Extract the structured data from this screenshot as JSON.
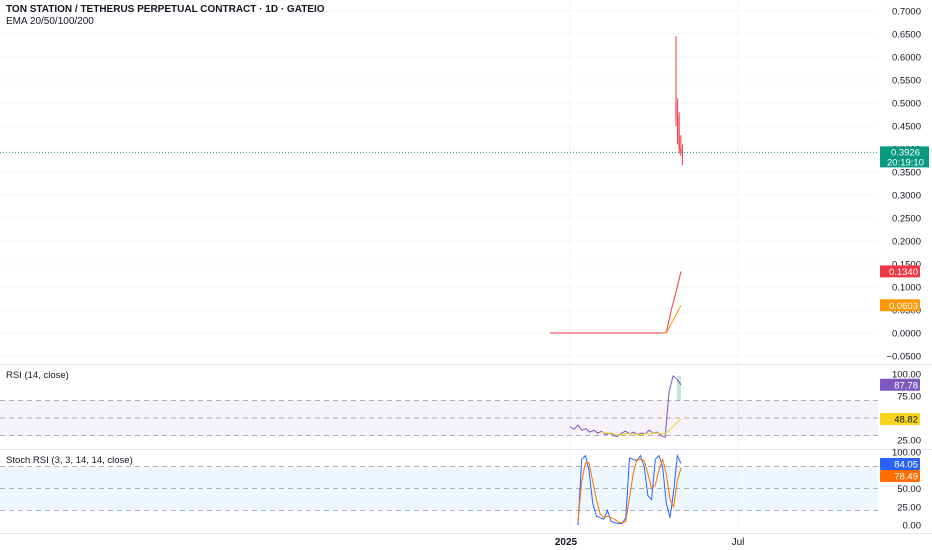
{
  "header": {
    "title": "TON STATION / TETHERUS PERPETUAL CONTRACT · 1D · GATEIO",
    "indicator": "EMA 20/50/100/200"
  },
  "price_badges": {
    "last_price": "0.3926",
    "countdown": "20:19:10",
    "ema_red": "0.1340",
    "ema_orange": "0.0603",
    "colors": {
      "last": "#089981",
      "ema_red": "#f23645",
      "ema_orange": "#ff9800"
    }
  },
  "rsi_pane": {
    "label": "RSI (14, close)",
    "rsi_value": "87.78",
    "ma_value": "48.82",
    "colors": {
      "rsi": "#7e57c2",
      "ma": "#f7d51d"
    }
  },
  "stoch_pane": {
    "label": "Stoch RSI (3, 3, 14, 14, close)",
    "k_value": "84.05",
    "d_value": "78.49",
    "colors": {
      "k": "#2962ff",
      "d": "#ff6d00"
    }
  },
  "chart_data": [
    {
      "type": "candlestick",
      "title": "TON STATION / TETHERUS PERPETUAL CONTRACT · 1D · GATEIO",
      "ylim": [
        -0.05,
        0.7
      ],
      "y_ticks": [
        "0.7000",
        "0.6500",
        "0.6000",
        "0.5500",
        "0.5000",
        "0.4500",
        "0.4000",
        "0.3500",
        "0.3000",
        "0.2500",
        "0.2000",
        "0.1500",
        "0.1000",
        "0.0500",
        "0.0000",
        "−0.0500"
      ],
      "x_ticks": [
        "2025",
        "Jul"
      ],
      "grid": true,
      "last_price": 0.3926,
      "candles": [
        {
          "o": 0.5,
          "h": 0.645,
          "l": 0.45,
          "c": 0.47
        },
        {
          "o": 0.47,
          "h": 0.51,
          "l": 0.41,
          "c": 0.43
        },
        {
          "o": 0.43,
          "h": 0.48,
          "l": 0.39,
          "c": 0.4
        },
        {
          "o": 0.4,
          "h": 0.43,
          "l": 0.385,
          "c": 0.395
        },
        {
          "o": 0.395,
          "h": 0.41,
          "l": 0.365,
          "c": 0.3926
        }
      ],
      "series": [
        {
          "name": "EMA 20",
          "color": "#f23645",
          "x": [
            0,
            1,
            2,
            3,
            4,
            5,
            6,
            7,
            8,
            9,
            10,
            11,
            12,
            13,
            14,
            15,
            16,
            17,
            18,
            19,
            20,
            21,
            22,
            23,
            24,
            25,
            26,
            27
          ],
          "values": [
            0,
            0,
            0,
            0,
            0,
            0,
            0,
            0,
            0,
            0,
            0,
            0,
            0,
            0,
            0,
            0,
            0,
            0,
            0,
            0,
            0,
            0,
            0,
            0,
            0.0016,
            0.05,
            0.09,
            0.134
          ]
        },
        {
          "name": "EMA 50",
          "color": "#ff9800",
          "x": [
            23,
            24,
            25,
            26,
            27
          ],
          "values": [
            0,
            0.0006,
            0.02,
            0.04,
            0.0603
          ]
        }
      ]
    },
    {
      "type": "line",
      "title": "RSI (14, close)",
      "ylim": [
        20,
        100
      ],
      "y_ticks": [
        "100.00",
        "75.00",
        "25.00"
      ],
      "bands": [
        30,
        50,
        70
      ],
      "series": [
        {
          "name": "RSI",
          "color": "#7e57c2",
          "values": [
            40,
            37,
            42,
            36,
            38,
            34,
            36,
            33,
            35,
            31,
            33,
            30,
            29,
            33,
            35,
            32,
            34,
            31,
            33,
            32,
            36,
            33,
            34,
            30,
            28,
            80,
            98,
            94,
            87.78
          ]
        },
        {
          "name": "RSI MA",
          "color": "#f7d51d",
          "values": [
            null,
            null,
            null,
            null,
            null,
            null,
            null,
            null,
            34,
            33,
            33,
            32,
            31,
            31,
            32,
            32,
            32,
            31,
            31,
            32,
            32,
            33,
            33,
            32,
            32,
            36,
            40,
            45,
            48.82
          ]
        }
      ]
    },
    {
      "type": "line",
      "title": "Stoch RSI (3, 3, 14, 14, close)",
      "ylim": [
        0,
        100
      ],
      "y_ticks": [
        "100.00",
        "50.00",
        "25.00",
        "0.00"
      ],
      "bands": [
        20,
        50,
        80
      ],
      "series": [
        {
          "name": "K",
          "color": "#2962ff",
          "values": [
            0,
            90,
            95,
            75,
            30,
            12,
            10,
            8,
            20,
            5,
            3,
            2,
            2,
            10,
            92,
            90,
            88,
            95,
            80,
            40,
            35,
            90,
            95,
            80,
            30,
            10,
            45,
            95,
            84.05
          ]
        },
        {
          "name": "D",
          "color": "#ff6d00",
          "values": [
            5,
            60,
            85,
            85,
            60,
            35,
            15,
            10,
            12,
            10,
            8,
            4,
            3,
            5,
            38,
            70,
            90,
            90,
            88,
            70,
            50,
            55,
            75,
            90,
            70,
            35,
            25,
            60,
            78.49
          ]
        }
      ]
    }
  ]
}
